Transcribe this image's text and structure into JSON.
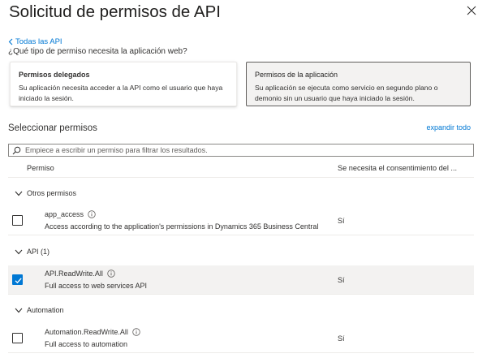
{
  "header": {
    "title": "Solicitud de permisos de API",
    "back_link": "Todas las API",
    "question": "¿Qué tipo de permiso necesita la aplicación web?"
  },
  "permission_types": [
    {
      "title": "Permisos delegados",
      "description": "Su aplicación necesita acceder a la API como el usuario que haya iniciado la sesión.",
      "selected": false
    },
    {
      "title": "Permisos de la aplicación",
      "description": "Su aplicación se ejecuta como servicio en segundo plano o demonio sin un usuario que haya iniciado la sesión.",
      "selected": true
    }
  ],
  "select_section": {
    "heading": "Seleccionar permisos",
    "expand_all": "expandir todo",
    "search_placeholder": "Empiece a escribir un permiso para filtrar los resultados."
  },
  "table": {
    "columns": [
      "Permiso",
      "Se necesita el consentimiento del ..."
    ],
    "groups": [
      {
        "label": "Otros permisos",
        "items": [
          {
            "name": "app_access",
            "description": "Access according to the application's permissions in Dynamics 365 Business Central",
            "consent": "Sí",
            "checked": false
          }
        ]
      },
      {
        "label": "API (1)",
        "items": [
          {
            "name": "API.ReadWrite.All",
            "description": "Full access to web services API",
            "consent": "Sí",
            "checked": true
          }
        ]
      },
      {
        "label": "Automation",
        "items": [
          {
            "name": "Automation.ReadWrite.All",
            "description": "Full access to automation",
            "consent": "Sí",
            "checked": false
          }
        ]
      }
    ]
  },
  "colors": {
    "accent": "#0078d4",
    "selected_bg": "#f3f2f1",
    "text": "#323130"
  },
  "icons": [
    "close-icon",
    "chevron-left-icon",
    "search-icon",
    "chevron-down-icon",
    "info-icon",
    "checkmark-icon"
  ]
}
